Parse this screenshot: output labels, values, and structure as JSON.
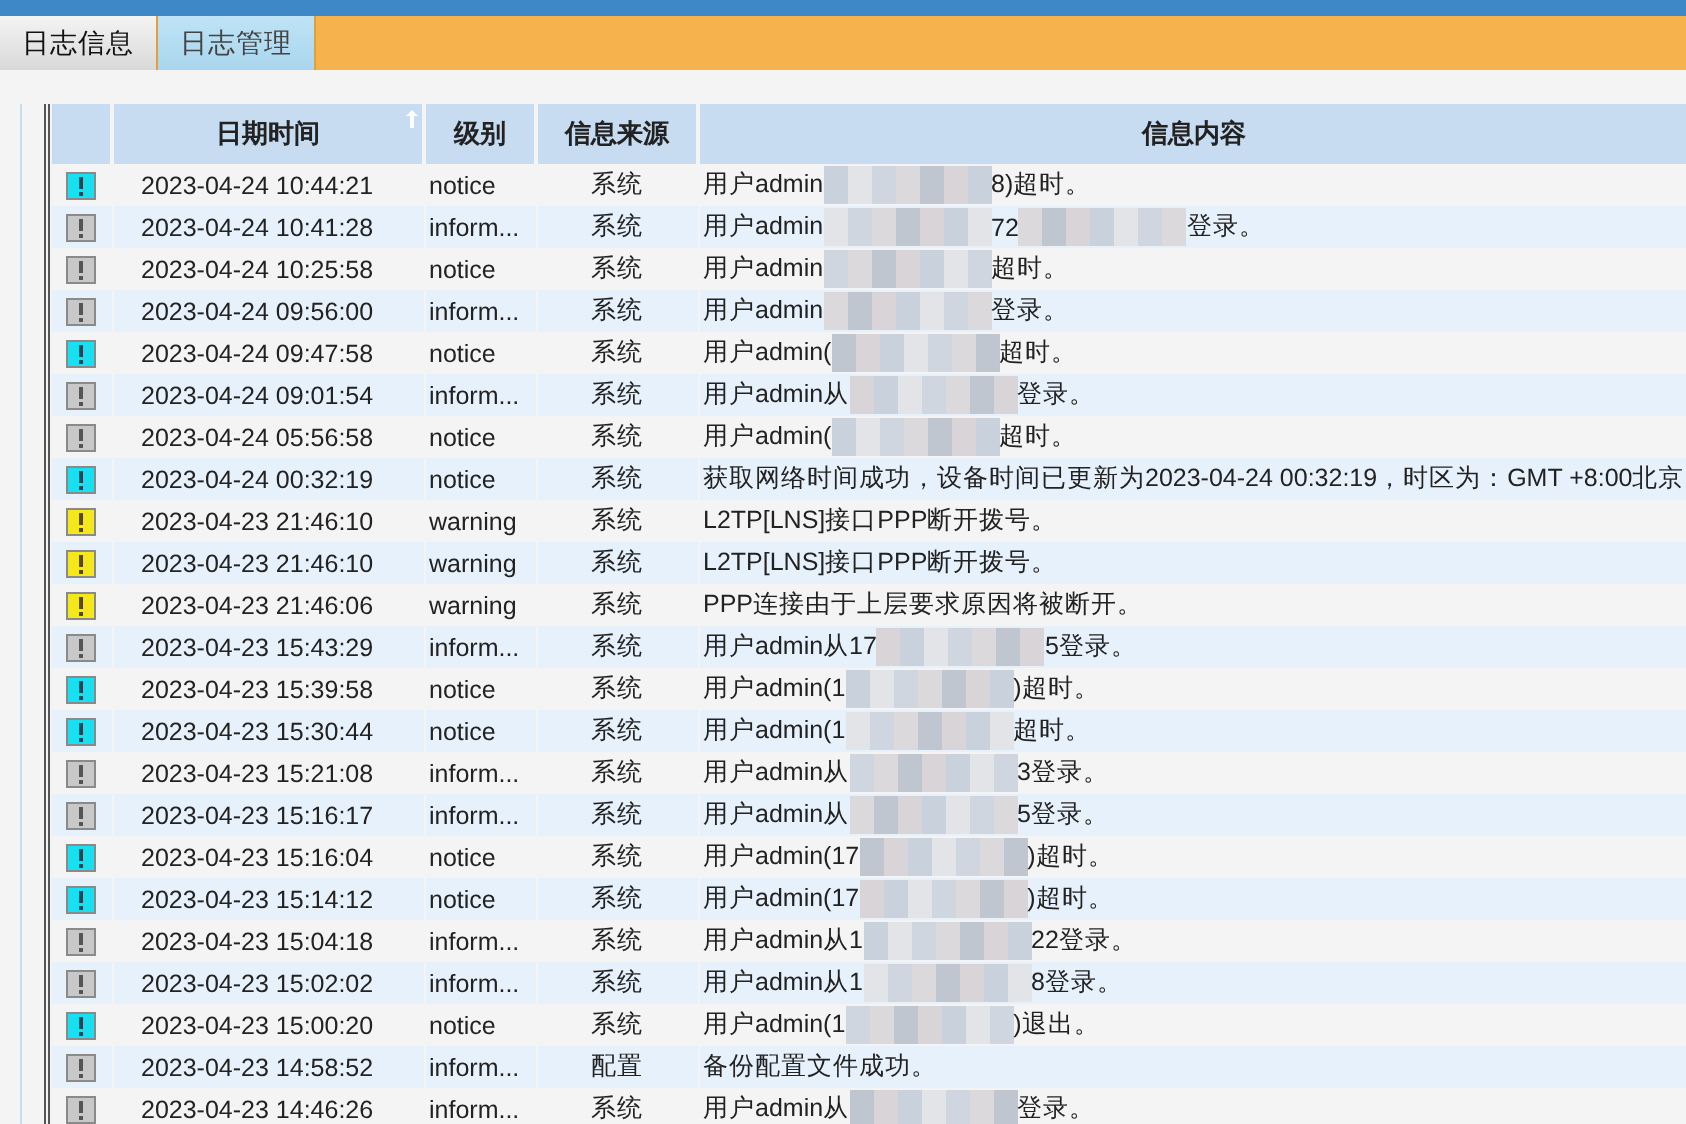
{
  "tabs": [
    {
      "label": "日志信息",
      "selected": true
    },
    {
      "label": "日志管理",
      "selected": false
    }
  ],
  "table": {
    "columns": [
      {
        "label": "日期时间",
        "sorted": true
      },
      {
        "label": "级别",
        "sorted": false
      },
      {
        "label": "信息来源",
        "sorted": false
      },
      {
        "label": "信息内容",
        "sorted": false
      }
    ],
    "rows": [
      {
        "kind": "notice",
        "datetime": "2023-04-24 10:44:21",
        "level": "notice",
        "source": "系统",
        "message": [
          {
            "text": "用户admin"
          },
          {
            "kind": "redacted"
          },
          {
            "text": "8)超时。"
          }
        ]
      },
      {
        "kind": "info",
        "datetime": "2023-04-24 10:41:28",
        "level": "inform...",
        "source": "系统",
        "message": [
          {
            "text": "用户admin"
          },
          {
            "kind": "redacted"
          },
          {
            "text": "72"
          },
          {
            "kind": "redacted"
          },
          {
            "text": "登录。"
          }
        ]
      },
      {
        "kind": "info",
        "datetime": "2023-04-24 10:25:58",
        "level": "notice",
        "source": "系统",
        "message": [
          {
            "text": "用户admin"
          },
          {
            "kind": "redacted"
          },
          {
            "text": "超时。"
          }
        ]
      },
      {
        "kind": "info",
        "datetime": "2023-04-24 09:56:00",
        "level": "inform...",
        "source": "系统",
        "message": [
          {
            "text": "用户admin"
          },
          {
            "kind": "redacted"
          },
          {
            "text": "登录。"
          }
        ]
      },
      {
        "kind": "notice",
        "datetime": "2023-04-24 09:47:58",
        "level": "notice",
        "source": "系统",
        "message": [
          {
            "text": "用户admin("
          },
          {
            "kind": "redacted"
          },
          {
            "text": "超时。"
          }
        ]
      },
      {
        "kind": "info",
        "datetime": "2023-04-24 09:01:54",
        "level": "inform...",
        "source": "系统",
        "message": [
          {
            "text": "用户admin从"
          },
          {
            "kind": "redacted"
          },
          {
            "text": "登录。"
          }
        ]
      },
      {
        "kind": "info",
        "datetime": "2023-04-24 05:56:58",
        "level": "notice",
        "source": "系统",
        "message": [
          {
            "text": "用户admin("
          },
          {
            "kind": "redacted"
          },
          {
            "text": "超时。"
          }
        ]
      },
      {
        "kind": "notice",
        "datetime": "2023-04-24 00:32:19",
        "level": "notice",
        "source": "系统",
        "message": [
          {
            "text": "获取网络时间成功，设备时间已更新为2023-04-24 00:32:19，时区为：GMT +8:00北京"
          }
        ]
      },
      {
        "kind": "warning",
        "datetime": "2023-04-23 21:46:10",
        "level": "warning",
        "source": "系统",
        "message": [
          {
            "text": "L2TP[LNS]接口PPP断开拨号。"
          }
        ]
      },
      {
        "kind": "warning",
        "datetime": "2023-04-23 21:46:10",
        "level": "warning",
        "source": "系统",
        "message": [
          {
            "text": "L2TP[LNS]接口PPP断开拨号。"
          }
        ]
      },
      {
        "kind": "warning",
        "datetime": "2023-04-23 21:46:06",
        "level": "warning",
        "source": "系统",
        "message": [
          {
            "text": "PPP连接由于上层要求原因将被断开。"
          }
        ]
      },
      {
        "kind": "info",
        "datetime": "2023-04-23 15:43:29",
        "level": "inform...",
        "source": "系统",
        "message": [
          {
            "text": "用户admin从17"
          },
          {
            "kind": "redacted"
          },
          {
            "text": "5登录。"
          }
        ]
      },
      {
        "kind": "notice",
        "datetime": "2023-04-23 15:39:58",
        "level": "notice",
        "source": "系统",
        "message": [
          {
            "text": "用户admin(1"
          },
          {
            "kind": "redacted"
          },
          {
            "text": ")超时。"
          }
        ]
      },
      {
        "kind": "notice",
        "datetime": "2023-04-23 15:30:44",
        "level": "notice",
        "source": "系统",
        "message": [
          {
            "text": "用户admin(1"
          },
          {
            "kind": "redacted"
          },
          {
            "text": "超时。"
          }
        ]
      },
      {
        "kind": "info",
        "datetime": "2023-04-23 15:21:08",
        "level": "inform...",
        "source": "系统",
        "message": [
          {
            "text": "用户admin从"
          },
          {
            "kind": "redacted"
          },
          {
            "text": "3登录。"
          }
        ]
      },
      {
        "kind": "info",
        "datetime": "2023-04-23 15:16:17",
        "level": "inform...",
        "source": "系统",
        "message": [
          {
            "text": "用户admin从"
          },
          {
            "kind": "redacted"
          },
          {
            "text": "5登录。"
          }
        ]
      },
      {
        "kind": "notice",
        "datetime": "2023-04-23 15:16:04",
        "level": "notice",
        "source": "系统",
        "message": [
          {
            "text": "用户admin(17"
          },
          {
            "kind": "redacted"
          },
          {
            "text": ")超时。"
          }
        ]
      },
      {
        "kind": "notice",
        "datetime": "2023-04-23 15:14:12",
        "level": "notice",
        "source": "系统",
        "message": [
          {
            "text": "用户admin(17"
          },
          {
            "kind": "redacted"
          },
          {
            "text": ")超时。"
          }
        ]
      },
      {
        "kind": "info",
        "datetime": "2023-04-23 15:04:18",
        "level": "inform...",
        "source": "系统",
        "message": [
          {
            "text": "用户admin从1"
          },
          {
            "kind": "redacted"
          },
          {
            "text": "22登录。"
          }
        ]
      },
      {
        "kind": "info",
        "datetime": "2023-04-23 15:02:02",
        "level": "inform...",
        "source": "系统",
        "message": [
          {
            "text": "用户admin从1"
          },
          {
            "kind": "redacted"
          },
          {
            "text": "8登录。"
          }
        ]
      },
      {
        "kind": "notice",
        "datetime": "2023-04-23 15:00:20",
        "level": "notice",
        "source": "系统",
        "message": [
          {
            "text": "用户admin(1"
          },
          {
            "kind": "redacted"
          },
          {
            "text": ")退出。"
          }
        ]
      },
      {
        "kind": "info",
        "datetime": "2023-04-23 14:58:52",
        "level": "inform...",
        "source": "配置",
        "message": [
          {
            "text": "备份配置文件成功。"
          }
        ]
      },
      {
        "kind": "info",
        "datetime": "2023-04-23 14:46:26",
        "level": "inform...",
        "source": "系统",
        "message": [
          {
            "text": "用户admin从"
          },
          {
            "kind": "redacted"
          },
          {
            "text": "登录。"
          }
        ]
      }
    ]
  }
}
